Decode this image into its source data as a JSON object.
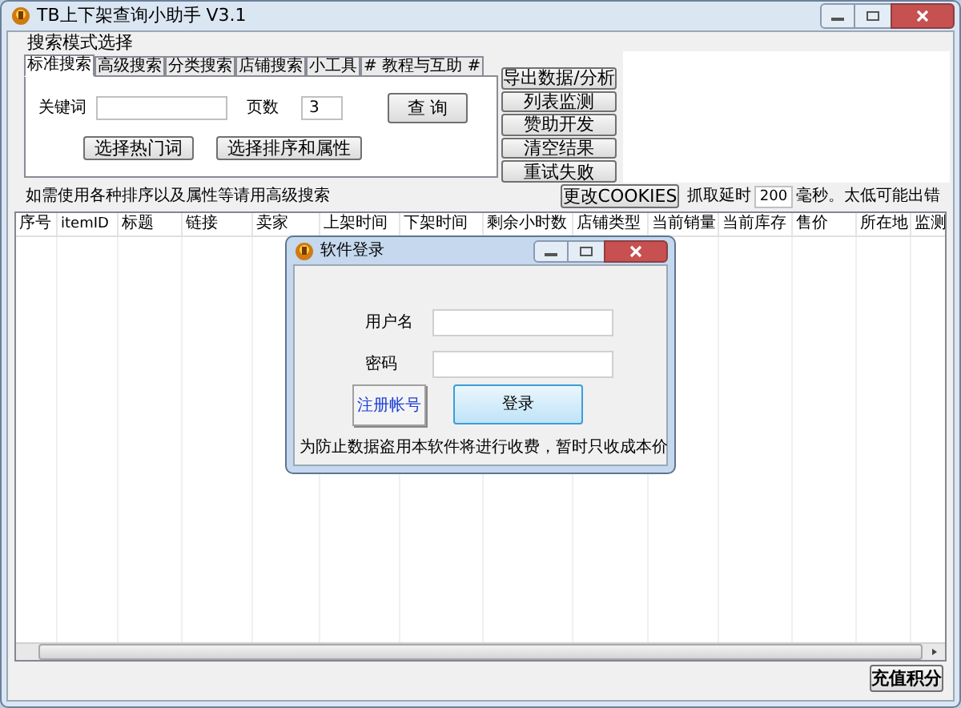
{
  "window": {
    "title": "TB上下架查询小助手 V3.1"
  },
  "search_group": {
    "title": "搜索模式选择",
    "tabs": [
      {
        "label": "标准搜索",
        "selected": true
      },
      {
        "label": "高级搜索",
        "selected": false
      },
      {
        "label": "分类搜索",
        "selected": false
      },
      {
        "label": "店铺搜索",
        "selected": false
      },
      {
        "label": "小工具",
        "selected": false
      },
      {
        "label": "# 教程与互助 #",
        "selected": false
      }
    ],
    "keyword_label": "关键词",
    "pages_label": "页数",
    "pages_value": "3",
    "query_button": "查 询",
    "buttons": [
      "选择热门词",
      "选择排序和属性"
    ]
  },
  "side_buttons": [
    "导出数据/分析",
    "列表监测",
    "赞助开发",
    "清空结果",
    "重试失败"
  ],
  "hint": "如需使用各种排序以及属性等请用高级搜索",
  "cookies_button": "更改COOKIES",
  "delay_label": "抓取延时",
  "delay_value": "200",
  "delay_note": "毫秒。太低可能出错",
  "table": {
    "columns": [
      "序号",
      "itemID",
      "标题",
      "链接",
      "卖家",
      "上架时间",
      "下架时间",
      "剩余小时数",
      "店铺类型",
      "当前销量",
      "当前库存",
      "售价",
      "所在地",
      "监测"
    ]
  },
  "recharge_button": "充值积分",
  "dialog": {
    "title": "软件登录",
    "username_label": "用户名",
    "password_label": "密码",
    "register_button": "注册帐号",
    "login_button": "登录",
    "notice": "为防止数据盗用本软件将进行收费，暂时只收成本价"
  }
}
